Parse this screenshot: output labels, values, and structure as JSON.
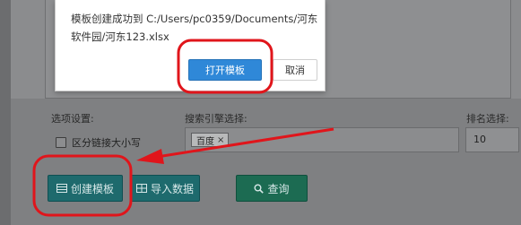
{
  "dialog": {
    "message": "模板创建成功到 C:/Users/pc0359/Documents/河东软件园/河东123.xlsx",
    "open_label": "打开模板",
    "cancel_label": "取消"
  },
  "form": {
    "options_label": "选项设置:",
    "checkbox_label": "区分链接大小写",
    "search_engine_label": "搜索引擎选择:",
    "selected_engine": "百度",
    "tag_remove": "×",
    "rank_label": "排名选择:",
    "rank_value": "10"
  },
  "actions": {
    "create_label": "创建模板",
    "import_label": "导入数据",
    "query_label": "查询"
  },
  "annotation": {
    "color": "#e0151b"
  },
  "colors": {
    "primary_blue": "#2f88d8",
    "teal_button": "#1e6a6d",
    "green_button": "#1c6b52"
  }
}
